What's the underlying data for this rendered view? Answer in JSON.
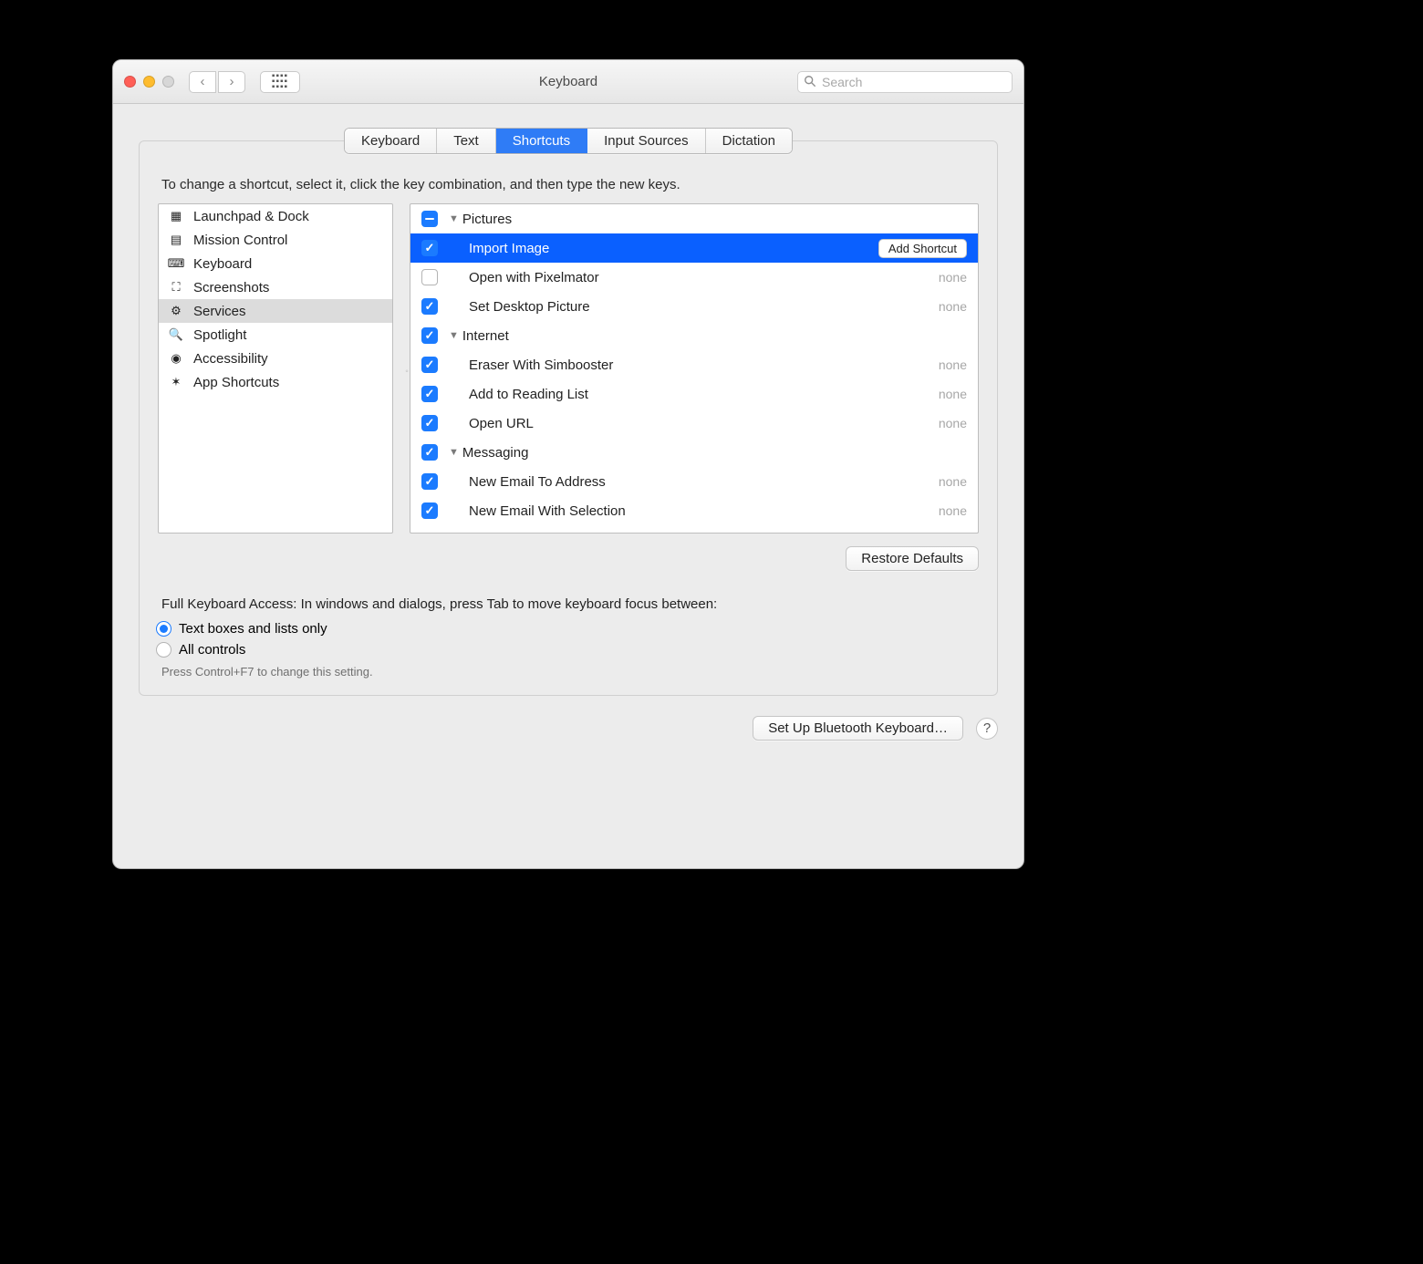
{
  "window": {
    "title": "Keyboard"
  },
  "toolbar": {
    "search_placeholder": "Search"
  },
  "tabs": [
    "Keyboard",
    "Text",
    "Shortcuts",
    "Input Sources",
    "Dictation"
  ],
  "active_tab": 2,
  "instruction": "To change a shortcut, select it, click the key combination, and then type the new keys.",
  "sidebar": {
    "items": [
      {
        "label": "Launchpad & Dock",
        "icon": "launchpad-icon"
      },
      {
        "label": "Mission Control",
        "icon": "mission-control-icon"
      },
      {
        "label": "Keyboard",
        "icon": "keyboard-icon"
      },
      {
        "label": "Screenshots",
        "icon": "screenshots-icon"
      },
      {
        "label": "Services",
        "icon": "services-icon"
      },
      {
        "label": "Spotlight",
        "icon": "spotlight-icon"
      },
      {
        "label": "Accessibility",
        "icon": "accessibility-icon"
      },
      {
        "label": "App Shortcuts",
        "icon": "app-shortcuts-icon"
      }
    ],
    "active": 4
  },
  "rows": [
    {
      "type": "group",
      "label": "Pictures",
      "cb": "mixed"
    },
    {
      "type": "item",
      "label": "Import Image",
      "cb": "on",
      "selected": true,
      "action": "Add Shortcut"
    },
    {
      "type": "item",
      "label": "Open with Pixelmator",
      "cb": "off",
      "shortcut": "none"
    },
    {
      "type": "item",
      "label": "Set Desktop Picture",
      "cb": "on",
      "shortcut": "none"
    },
    {
      "type": "group",
      "label": "Internet",
      "cb": "on"
    },
    {
      "type": "item",
      "label": "Eraser With Simbooster",
      "cb": "on",
      "shortcut": "none"
    },
    {
      "type": "item",
      "label": "Add to Reading List",
      "cb": "on",
      "shortcut": "none"
    },
    {
      "type": "item",
      "label": "Open URL",
      "cb": "on",
      "shortcut": "none"
    },
    {
      "type": "group",
      "label": "Messaging",
      "cb": "on"
    },
    {
      "type": "item",
      "label": "New Email To Address",
      "cb": "on",
      "shortcut": "none"
    },
    {
      "type": "item",
      "label": "New Email With Selection",
      "cb": "on",
      "shortcut": "none"
    }
  ],
  "restore_label": "Restore Defaults",
  "fka": {
    "text": "Full Keyboard Access: In windows and dialogs, press Tab to move keyboard focus between:",
    "options": [
      "Text boxes and lists only",
      "All controls"
    ],
    "selected": 0,
    "hint": "Press Control+F7 to change this setting."
  },
  "footer": {
    "bluetooth": "Set Up Bluetooth Keyboard…"
  }
}
